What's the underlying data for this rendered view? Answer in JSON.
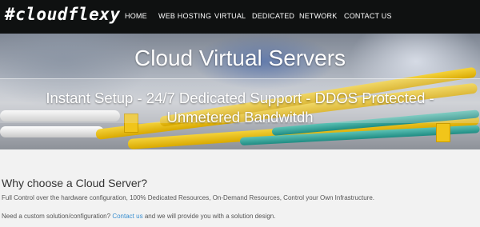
{
  "brand": {
    "logo_text": "#cloudflexy"
  },
  "nav": {
    "items": [
      "HOME",
      "WEB HOSTING",
      "VIRTUAL",
      "DEDICATED",
      "NETWORK",
      "CONTACT US"
    ]
  },
  "hero": {
    "title": "Cloud Virtual Servers",
    "subtitle": "Instant Setup - 24/7 Dedicated Support - DDOS Protected - Unmetered Bandwitdh"
  },
  "main": {
    "section_title": "Why choose a Cloud Server?",
    "paragraph1": "Full Control over the hardware configuration, 100% Dedicated Resources, On-Demand Resources, Control your Own Infrastructure.",
    "paragraph2_before": "Need a custom solution/configuration?",
    "paragraph2_link": "Contact us",
    "paragraph2_after": "and we will provide you with a solution design."
  },
  "colors": {
    "nav_bg": "#0f1111",
    "link": "#3a8fd0",
    "page_bg": "#f2f2f2"
  }
}
